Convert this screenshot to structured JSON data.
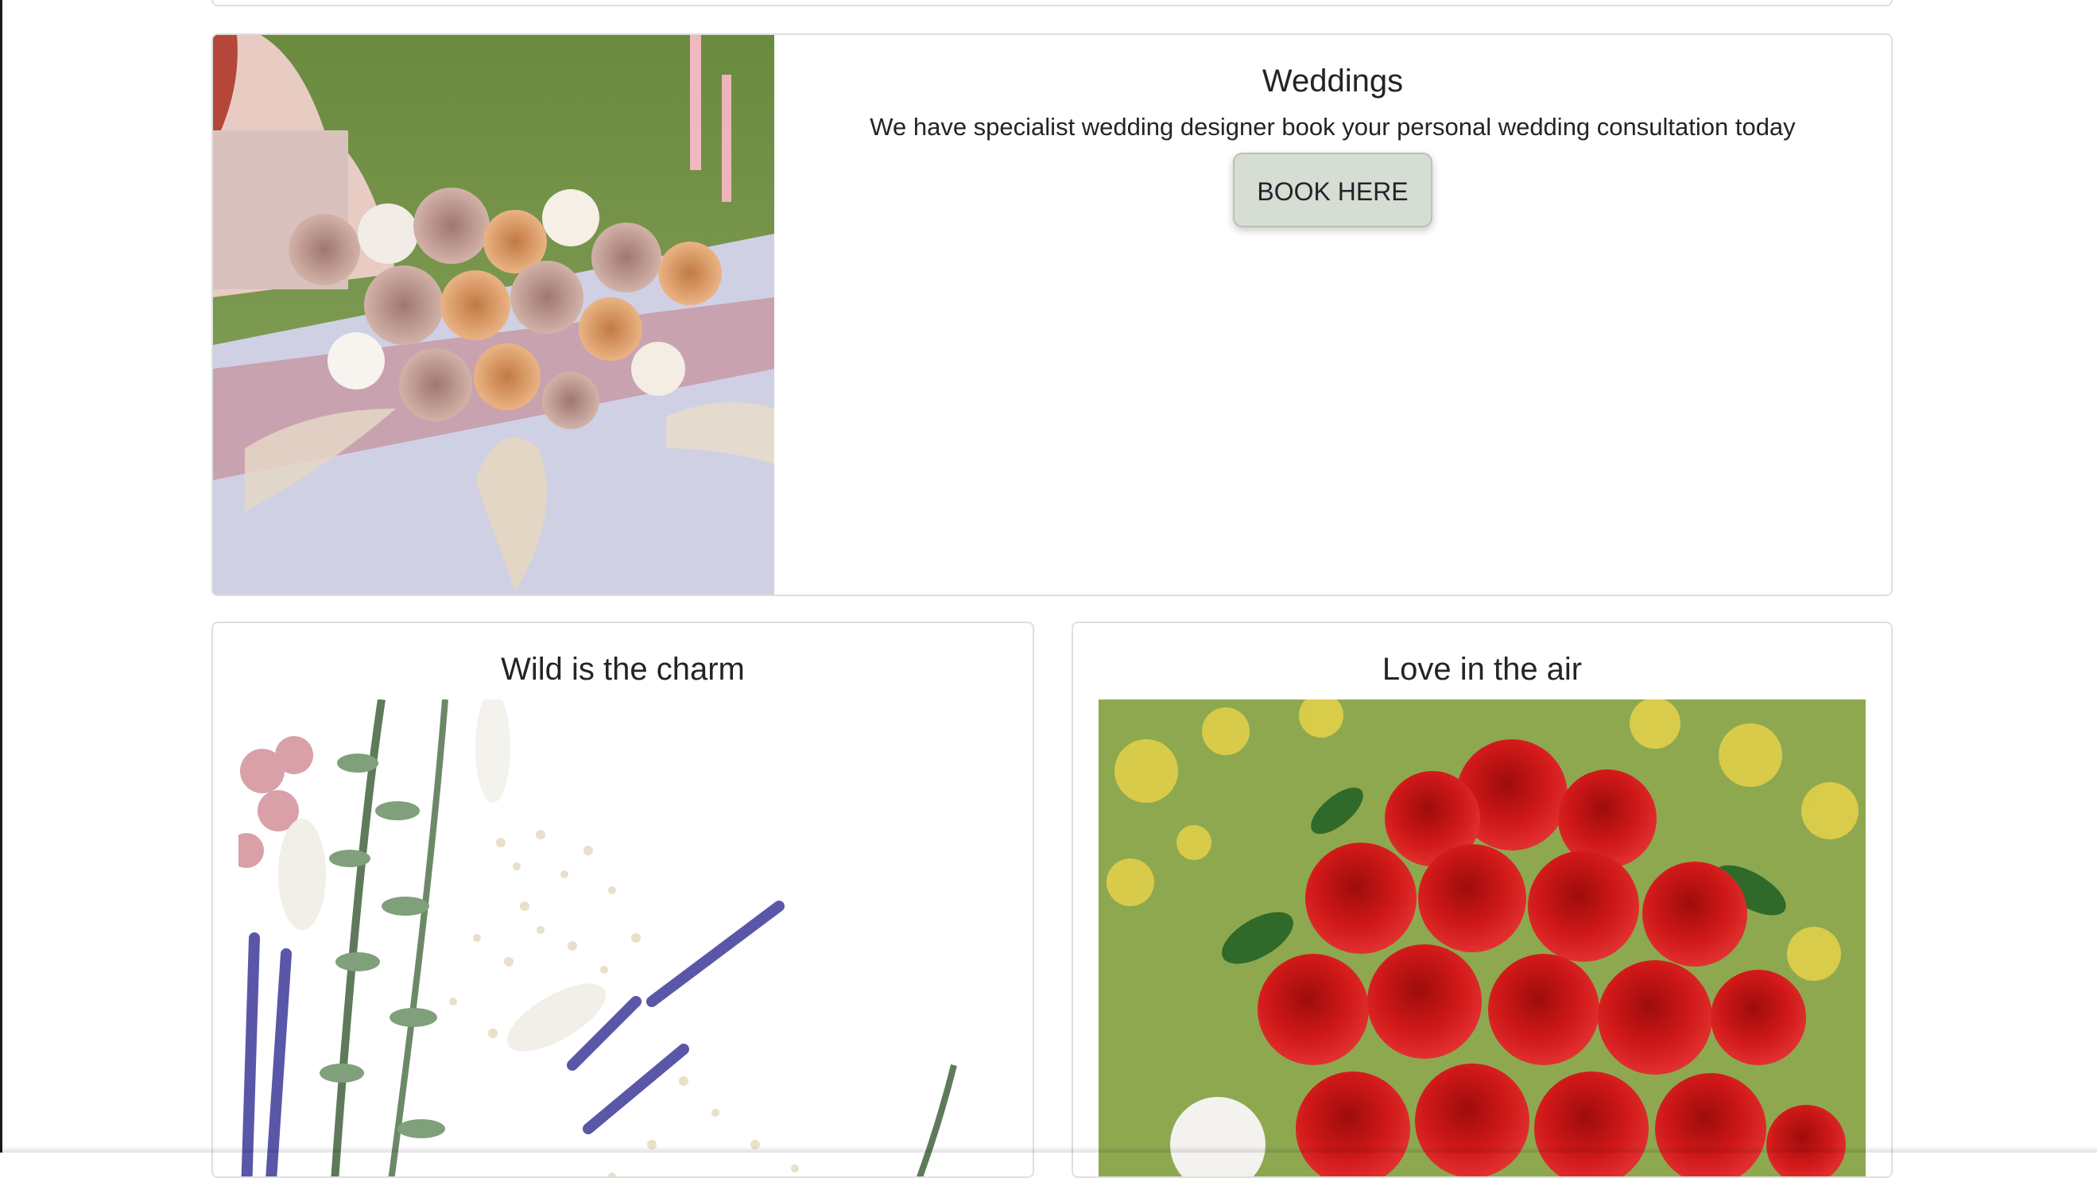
{
  "cards": {
    "wedding": {
      "title": "Weddings",
      "text": "We have specialist wedding designer book your personal wedding consultation today",
      "button_label": "BOOK HERE"
    },
    "wild": {
      "title": "Wild is the charm"
    },
    "love": {
      "title": "Love in the air"
    }
  },
  "colors": {
    "button_bg": "#d6ddd2",
    "card_border": "#dfdfdf",
    "rose_red": "#d01818"
  }
}
